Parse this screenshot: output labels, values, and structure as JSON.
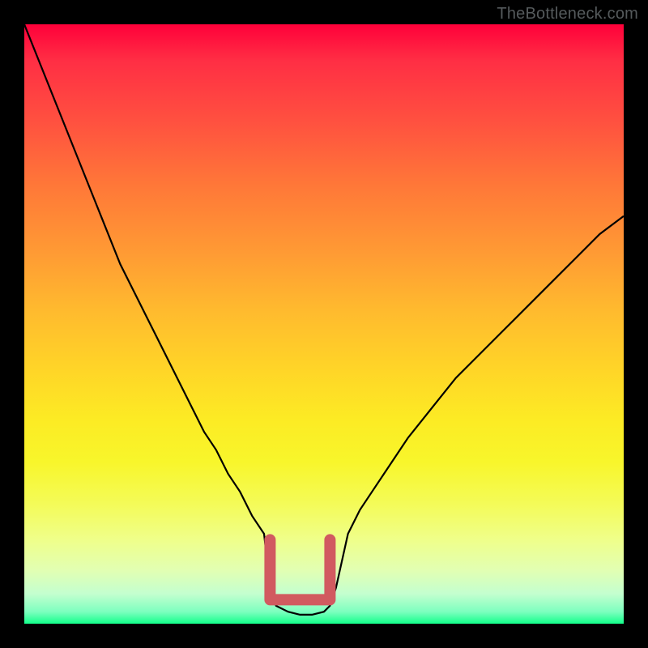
{
  "watermark": {
    "text": "TheBottleneck.com"
  },
  "chart_data": {
    "type": "line",
    "title": "",
    "xlabel": "",
    "ylabel": "",
    "xlim": [
      0,
      100
    ],
    "ylim": [
      0,
      100
    ],
    "grid": false,
    "legend": false,
    "series": [
      {
        "name": "bottleneck-curve",
        "x": [
          0,
          2,
          4,
          6,
          8,
          10,
          12,
          14,
          16,
          18,
          20,
          22,
          24,
          26,
          28,
          30,
          32,
          34,
          36,
          38,
          40,
          41,
          42,
          44,
          46,
          48,
          50,
          51,
          52,
          54,
          56,
          58,
          60,
          64,
          68,
          72,
          76,
          80,
          84,
          88,
          92,
          96,
          100
        ],
        "values": [
          100,
          95,
          90,
          85,
          80,
          75,
          70,
          65,
          60,
          56,
          52,
          48,
          44,
          40,
          36,
          32,
          29,
          25,
          22,
          18,
          15,
          6,
          3,
          2,
          1.5,
          1.5,
          2,
          3,
          6,
          15,
          19,
          22,
          25,
          31,
          36,
          41,
          45,
          49,
          53,
          57,
          61,
          65,
          68
        ]
      }
    ],
    "flat_zone": {
      "x_start": 41,
      "x_end": 51,
      "y": 4
    },
    "colors": {
      "curve": "#000000",
      "flat_cap": "#d15a60",
      "gradient_top": "#ff003a",
      "gradient_bottom": "#12ff8a"
    }
  }
}
